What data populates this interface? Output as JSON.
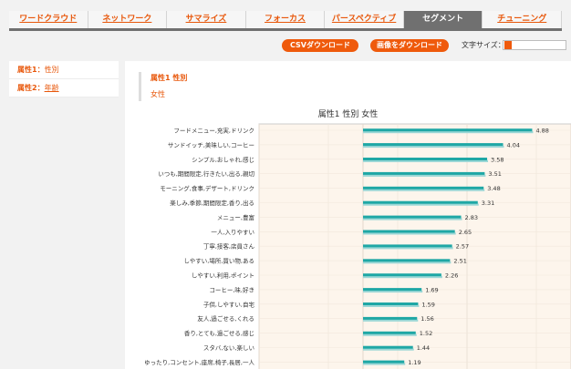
{
  "tabs": [
    {
      "label": "ワードクラウド",
      "active": false
    },
    {
      "label": "ネットワーク",
      "active": false
    },
    {
      "label": "サマライズ",
      "active": false
    },
    {
      "label": "フォーカス",
      "active": false
    },
    {
      "label": "パースペクティブ",
      "active": false
    },
    {
      "label": "セグメント",
      "active": true
    },
    {
      "label": "チューニング",
      "active": false
    }
  ],
  "toolbar": {
    "csv_label": "CSVダウンロード",
    "image_label": "画像をダウンロード",
    "font_size_label": "文字サイズ："
  },
  "sidebar": {
    "attributes": [
      {
        "key": "属性1：",
        "value": "性別"
      },
      {
        "key": "属性2：",
        "value": "年齢"
      }
    ]
  },
  "selection": {
    "title": "属性1 性別",
    "value": "女性"
  },
  "colors": {
    "accent": "#ef5a0c",
    "bar": "#1fa7a5",
    "plot_bg": "#fdf5ec"
  },
  "chart_data": {
    "type": "bar",
    "orientation": "horizontal",
    "title": "属性1 性別 女性",
    "xlim": [
      -3,
      6
    ],
    "grid": true,
    "categories": [
      "フードメニュー,充実,ドリンク",
      "サンドイッチ,美味しい,コーヒー",
      "シンプル,おしゃれ,感じ",
      "いつも,期間限定,行きたい,出る,親切",
      "モーニング,食事,デザート,ドリンク",
      "楽しみ,季節,期間限定,香り,出る",
      "メニュー,豊富",
      "一人,入りやすい",
      "丁寧,接客,店員さん",
      "しやすい,場所,買い物,ある",
      "しやすい,利用,ポイント",
      "コーヒー,味,好き",
      "子供,しやすい,自宅",
      "友人,過ごせる,くれる",
      "香り,とても,過ごせる,感じ",
      "スタバ,ない,楽しい",
      "ゆったり,コンセント,座席,椅子,長居,一人"
    ],
    "values": [
      4.88,
      4.04,
      3.58,
      3.51,
      3.48,
      3.31,
      2.83,
      2.65,
      2.57,
      2.51,
      2.26,
      1.69,
      1.59,
      1.56,
      1.52,
      1.44,
      1.19
    ]
  }
}
